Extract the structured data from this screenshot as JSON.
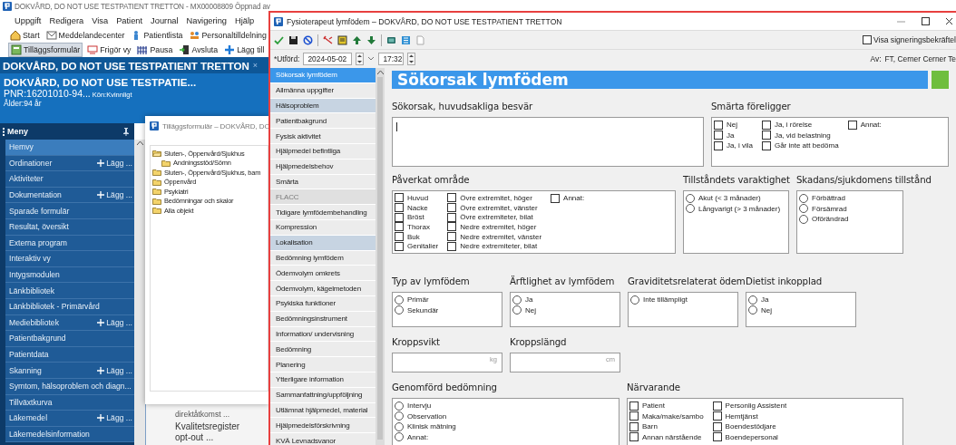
{
  "background_app": {
    "title": "DOKVÅRD, DO NOT USE TESTPATIENT TRETTON - MX00008809 Öppnad av",
    "menu": [
      "Uppgift",
      "Redigera",
      "Visa",
      "Patient",
      "Journal",
      "Navigering",
      "Hjälp"
    ],
    "toolbar": [
      "Start",
      "Meddelandecenter",
      "Patientlista",
      "Personaltilldelning"
    ],
    "form_toolbar": [
      {
        "label": "Tilläggsformulär",
        "pressed": true
      },
      {
        "label": "Frigör vy",
        "pressed": false
      },
      {
        "label": "Pausa",
        "pressed": false
      },
      {
        "label": "Avsluta",
        "pressed": false
      },
      {
        "label": "Lägg till",
        "pressed": false
      }
    ],
    "patient_tab": {
      "title": "DOKVÅRD, DO NOT USE TESTPATIENT TRETTON",
      "close": "×"
    },
    "patient": {
      "name": "DOKVÅRD, DO NOT USE TESTPATIE...",
      "pnr": "PNR:16201010-94...",
      "gender": "Kön:Kvinnligt",
      "age": "Ålder:94 år"
    },
    "menu_panel": {
      "title": "Meny",
      "items": [
        {
          "label": "Hemvy",
          "selected": true
        },
        {
          "label": "Ordinationer",
          "selected": false,
          "action": "Lägg ..."
        },
        {
          "label": "Aktiviteter",
          "selected": false
        },
        {
          "label": "Dokumentation",
          "selected": false,
          "action": "Lägg ..."
        },
        {
          "label": "Sparade formulär",
          "selected": false
        },
        {
          "label": "Resultat, översikt",
          "selected": false
        },
        {
          "label": "Externa program",
          "selected": false
        },
        {
          "label": "Interaktiv vy",
          "selected": false
        },
        {
          "label": "Intygsmodulen",
          "selected": false
        },
        {
          "label": "Länkbibliotek",
          "selected": false
        },
        {
          "label": "Länkbibliotek - Primärvård",
          "selected": false
        },
        {
          "label": "Mediebibliotek",
          "selected": false,
          "action": "Lägg ..."
        },
        {
          "label": "Patientbakgrund",
          "selected": false
        },
        {
          "label": "Patientdata",
          "selected": false
        },
        {
          "label": "Skanning",
          "selected": false,
          "action": "Lägg ..."
        },
        {
          "label": "Symtom, hälsoproblem och diagn...",
          "selected": false
        },
        {
          "label": "Tillväxtkurva",
          "selected": false
        },
        {
          "label": "Läkemedel",
          "selected": false,
          "action": "Lägg ..."
        },
        {
          "label": "Läkemedelsinformation",
          "selected": false
        }
      ]
    },
    "page_texts": [
      "direktåtkomst ...",
      "Kvalitetsregister opt-out ..."
    ]
  },
  "addon_dialog": {
    "title": "Tilläggsformulär – DOKVÅRD, DO",
    "tree": [
      {
        "label": "Sluten-, Öppenvård/Sjukhus",
        "expanded": true,
        "children": [
          {
            "label": "Andningsstöd/Sömn",
            "expanded": false
          }
        ]
      },
      {
        "label": "Sluten-, Öppenvård/Sjukhus, bam",
        "expanded": false
      },
      {
        "label": "Öppenvård",
        "expanded": false
      },
      {
        "label": "Psykiatri",
        "expanded": false
      },
      {
        "label": "Bedömningar och skalor",
        "expanded": false
      },
      {
        "label": "Alla objekt",
        "expanded": false
      }
    ]
  },
  "form_window": {
    "title": "Fysioterapeut lymfödem – DOKVÅRD, DO NOT USE TESTPATIENT TRETTON",
    "show_signing": {
      "label": "Visa signeringsbekräftel",
      "checked": false
    },
    "performed": {
      "label": "*Utförd:",
      "date": "2024-05-02",
      "time": "17:32"
    },
    "author": {
      "label": "Av:",
      "value": "FT, Cerner Cerner Te"
    },
    "nav": [
      {
        "label": "Sökorsak lymfödem",
        "selected": true,
        "highlighted": false,
        "disabled": false
      },
      {
        "label": "Allmänna uppgifter",
        "selected": false,
        "highlighted": false,
        "disabled": false
      },
      {
        "label": "Hälsoproblem",
        "selected": false,
        "highlighted": true,
        "disabled": false
      },
      {
        "label": "Patientbakgrund",
        "selected": false,
        "highlighted": false,
        "disabled": false
      },
      {
        "label": "Fysisk aktivitet",
        "selected": false,
        "highlighted": false,
        "disabled": false
      },
      {
        "label": "Hjälpmedel befintliga",
        "selected": false,
        "highlighted": false,
        "disabled": false
      },
      {
        "label": "Hjälpmedelsbehov",
        "selected": false,
        "highlighted": false,
        "disabled": false
      },
      {
        "label": "Smärta",
        "selected": false,
        "highlighted": false,
        "disabled": false
      },
      {
        "label": "FLACC",
        "selected": false,
        "highlighted": false,
        "disabled": true
      },
      {
        "label": "Tidigare lymfödembehandling",
        "selected": false,
        "highlighted": false,
        "disabled": false
      },
      {
        "label": "Kompression",
        "selected": false,
        "highlighted": false,
        "disabled": false
      },
      {
        "label": "Lokalisation",
        "selected": false,
        "highlighted": true,
        "disabled": false
      },
      {
        "label": "Bedömning lymfödem",
        "selected": false,
        "highlighted": false,
        "disabled": false
      },
      {
        "label": "Ödemvolym omkrets",
        "selected": false,
        "highlighted": false,
        "disabled": false
      },
      {
        "label": "Ödemvolym, kägelmetoden",
        "selected": false,
        "highlighted": false,
        "disabled": false
      },
      {
        "label": "Psykiska funktioner",
        "selected": false,
        "highlighted": false,
        "disabled": false
      },
      {
        "label": "Bedömningsinstrument",
        "selected": false,
        "highlighted": false,
        "disabled": false
      },
      {
        "label": "Information/ undervisning",
        "selected": false,
        "highlighted": false,
        "disabled": false
      },
      {
        "label": "Bedömning",
        "selected": false,
        "highlighted": false,
        "disabled": false
      },
      {
        "label": "Planering",
        "selected": false,
        "highlighted": false,
        "disabled": false
      },
      {
        "label": "Ytterligare information",
        "selected": false,
        "highlighted": false,
        "disabled": false
      },
      {
        "label": "Sammanfattning/uppföljning",
        "selected": false,
        "highlighted": false,
        "disabled": false
      },
      {
        "label": "Utlämnat hjälpmedel, material",
        "selected": false,
        "highlighted": false,
        "disabled": false
      },
      {
        "label": "Hjälpmedelsförskrivning",
        "selected": false,
        "highlighted": false,
        "disabled": false
      },
      {
        "label": "KVÄ Levnadsvanor",
        "selected": false,
        "highlighted": false,
        "disabled": false
      }
    ],
    "heading": "Sökorsak lymfödem",
    "rows": [
      [
        {
          "title": "Sökorsak, huvudsakliga besvär",
          "kind": "text"
        },
        {
          "title": "Smärta föreligger",
          "kind": "options",
          "columns": [
            [
              {
                "label": "Nej",
                "kind": "checkbox",
                "checked": false
              },
              {
                "label": "Ja",
                "kind": "checkbox",
                "checked": false
              },
              {
                "label": "Ja, i vila",
                "kind": "checkbox",
                "checked": false
              }
            ],
            [
              {
                "label": "Ja, i rörelse",
                "kind": "checkbox",
                "checked": false
              },
              {
                "label": "Ja, vid belastning",
                "kind": "checkbox",
                "checked": false
              },
              {
                "label": "Går inte att bedöma",
                "kind": "checkbox",
                "checked": false
              }
            ],
            [
              {
                "label": "Annat:",
                "kind": "checkbox",
                "checked": false
              }
            ]
          ]
        }
      ],
      [
        {
          "title": "Påverkat område",
          "kind": "options",
          "columns": [
            [
              {
                "label": "Huvud",
                "kind": "checkbox",
                "checked": false
              },
              {
                "label": "Nacke",
                "kind": "checkbox",
                "checked": false
              },
              {
                "label": "Bröst",
                "kind": "checkbox",
                "checked": false
              },
              {
                "label": "Thorax",
                "kind": "checkbox",
                "checked": false
              },
              {
                "label": "Buk",
                "kind": "checkbox",
                "checked": false
              },
              {
                "label": "Genitalier",
                "kind": "checkbox",
                "checked": false
              }
            ],
            [
              {
                "label": "Övre extremitet, höger",
                "kind": "checkbox",
                "checked": false
              },
              {
                "label": "Övre extremitet, vänster",
                "kind": "checkbox",
                "checked": false
              },
              {
                "label": "Övre extremiteter, bilat",
                "kind": "checkbox",
                "checked": false
              },
              {
                "label": "Nedre extremitet, höger",
                "kind": "checkbox",
                "checked": false
              },
              {
                "label": "Nedre extremitet, vänster",
                "kind": "checkbox",
                "checked": false
              },
              {
                "label": "Nedre extremiteter, bilat",
                "kind": "checkbox",
                "checked": false
              }
            ],
            [
              {
                "label": "Annat:",
                "kind": "checkbox",
                "checked": false
              }
            ]
          ]
        },
        {
          "title": "Tillståndets varaktighet",
          "kind": "options",
          "columns": [
            [
              {
                "label": "Akut (< 3 månader)",
                "kind": "radio",
                "checked": false
              },
              {
                "label": "Långvarigt (> 3 månader)",
                "kind": "radio",
                "checked": false
              }
            ]
          ]
        },
        {
          "title": "Skadans/sjukdomens tillstånd",
          "kind": "options",
          "columns": [
            [
              {
                "label": "Förbättrad",
                "kind": "radio",
                "checked": false
              },
              {
                "label": "Försämrad",
                "kind": "radio",
                "checked": false
              },
              {
                "label": "Oförändrad",
                "kind": "radio",
                "checked": false
              }
            ]
          ]
        }
      ],
      [
        {
          "title": "Typ av lymfödem",
          "kind": "options",
          "columns": [
            [
              {
                "label": "Primär",
                "kind": "radio",
                "checked": false
              },
              {
                "label": "Sekundär",
                "kind": "radio",
                "checked": false
              }
            ]
          ]
        },
        {
          "title": "Ärftlighet av lymfödem",
          "kind": "options",
          "columns": [
            [
              {
                "label": "Ja",
                "kind": "radio",
                "checked": false
              },
              {
                "label": "Nej",
                "kind": "radio",
                "checked": false
              }
            ]
          ]
        },
        {
          "title": "Graviditetsrelaterat ödem",
          "kind": "options",
          "columns": [
            [
              {
                "label": "Inte tillämpligt",
                "kind": "radio",
                "checked": false
              }
            ]
          ]
        },
        {
          "title": "Dietist inkopplad",
          "kind": "options",
          "columns": [
            [
              {
                "label": "Ja",
                "kind": "radio",
                "checked": false
              },
              {
                "label": "Nej",
                "kind": "radio",
                "checked": false
              }
            ]
          ]
        }
      ],
      [
        {
          "title": "Kroppsvikt",
          "kind": "number",
          "unit": "kg"
        },
        {
          "title": "Kroppslängd",
          "kind": "number",
          "unit": "cm"
        }
      ],
      [
        {
          "title": "Genomförd bedömning",
          "kind": "options",
          "columns": [
            [
              {
                "label": "Intervju",
                "kind": "radio",
                "checked": false
              },
              {
                "label": "Observation",
                "kind": "radio",
                "checked": false
              },
              {
                "label": "Klinisk mätning",
                "kind": "radio",
                "checked": false
              },
              {
                "label": "Annat:",
                "kind": "radio",
                "checked": false
              }
            ]
          ]
        },
        {
          "title": "Närvarande",
          "kind": "options",
          "columns": [
            [
              {
                "label": "Patient",
                "kind": "checkbox",
                "checked": false
              },
              {
                "label": "Maka/make/sambo",
                "kind": "checkbox",
                "checked": false
              },
              {
                "label": "Barn",
                "kind": "checkbox",
                "checked": false
              },
              {
                "label": "Annan närstående",
                "kind": "checkbox",
                "checked": false
              }
            ],
            [
              {
                "label": "Personlig Assistent",
                "kind": "checkbox",
                "checked": false
              },
              {
                "label": "Hemtjänst",
                "kind": "checkbox",
                "checked": false
              },
              {
                "label": "Boendestödjare",
                "kind": "checkbox",
                "checked": false
              },
              {
                "label": "Boendepersonal",
                "kind": "checkbox",
                "checked": false
              }
            ]
          ]
        }
      ]
    ]
  }
}
